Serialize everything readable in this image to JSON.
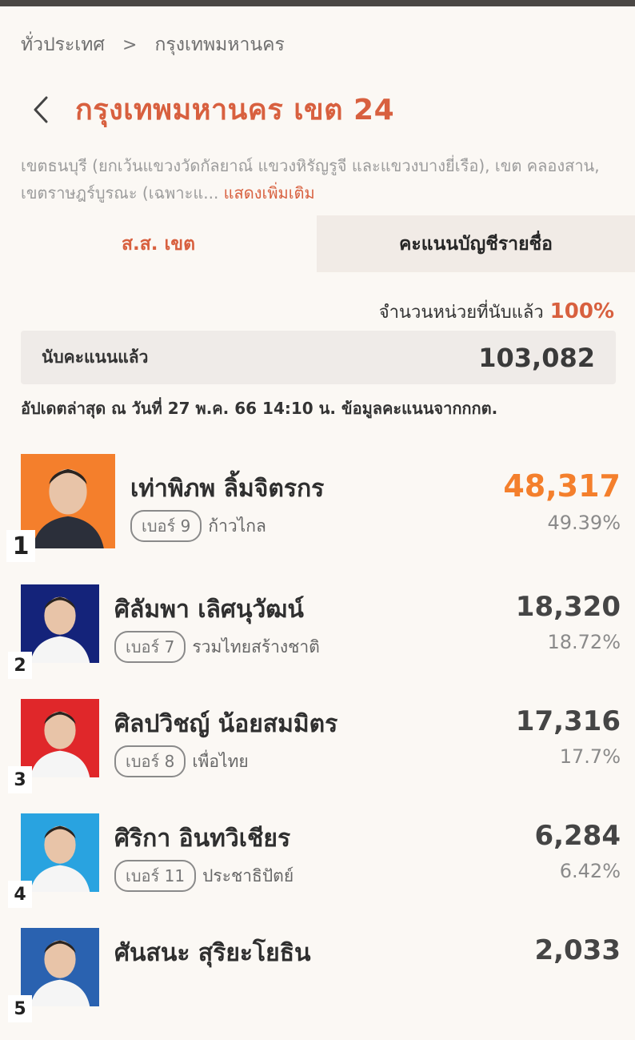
{
  "breadcrumb": {
    "items": [
      "ทั่วประเทศ",
      "กรุงเทพมหานคร"
    ],
    "separator": ">"
  },
  "header": {
    "title": "กรุงเทพมหานคร เขต 24"
  },
  "description": {
    "text": "เขตธนบุรี (ยกเว้นแขวงวัดกัลยาณ์ แขวงหิรัญรูจี และแขวงบางยี่เรือ), เขต คลองสาน, เขตราษฎร์บูรณะ (เฉพาะแ...",
    "more_label": "แสดงเพิ่มเติม"
  },
  "tabs": [
    {
      "label": "ส.ส. เขต",
      "active": true
    },
    {
      "label": "คะแนนบัญชีรายชื่อ",
      "active": false
    }
  ],
  "summary": {
    "units_counted_label": "จำนวนหน่วยที่นับแล้ว",
    "units_counted_pct": "100%",
    "votes_counted_label": "นับคะแนนแล้ว",
    "votes_counted_value": "103,082",
    "updated_text": "อัปเดตล่าสุด ณ วันที่ 27 พ.ค. 66 14:10 น. ข้อมูลคะแนนจากกกต."
  },
  "candidates": [
    {
      "rank": "1",
      "name": "เท่าพิภพ ลิ้มจิตรกร",
      "number_label": "เบอร์ 9",
      "party": "ก้าวไกล",
      "votes": "48,317",
      "percent": "49.39%",
      "photo_bg": "#f47f2c"
    },
    {
      "rank": "2",
      "name": "ศิลัมพา เลิศนุวัฒน์",
      "number_label": "เบอร์ 7",
      "party": "รวมไทยสร้างชาติ",
      "votes": "18,320",
      "percent": "18.72%",
      "photo_bg": "#14237a"
    },
    {
      "rank": "3",
      "name": "ศิลปวิชญ์ น้อยสมมิตร",
      "number_label": "เบอร์ 8",
      "party": "เพื่อไทย",
      "votes": "17,316",
      "percent": "17.7%",
      "photo_bg": "#e0272a"
    },
    {
      "rank": "4",
      "name": "ศิริกา อินทวิเชียร",
      "number_label": "เบอร์ 11",
      "party": "ประชาธิปัตย์",
      "votes": "6,284",
      "percent": "6.42%",
      "photo_bg": "#29a3e0"
    },
    {
      "rank": "5",
      "name": "ศันสนะ สุริยะโยธิน",
      "number_label": "",
      "party": "",
      "votes": "2,033",
      "percent": "",
      "photo_bg": "#2a62b0"
    }
  ],
  "colors": {
    "accent": "#d8603f",
    "leader": "#f47f2c"
  },
  "icons": {
    "back": "chevron-left-icon",
    "separator": "chevron-right-icon"
  }
}
